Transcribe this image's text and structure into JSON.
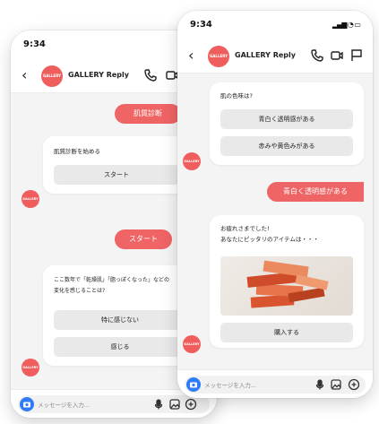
{
  "back_phone": {
    "time": "9:34",
    "brand": "GALLERY Reply",
    "avatar_text": "GALLERY",
    "messages": {
      "user1": "肌質診断",
      "card1_text": "肌質診断を始める",
      "card1_button": "スタート",
      "user2": "スタート",
      "card2_line1": "ここ数年で「乾燥肌」「脂っぽくなった」などの",
      "card2_line2": "変化を感じることは?",
      "card2_opt1": "特に感じない",
      "card2_opt2": "感じる"
    },
    "input_placeholder": "メッセージを入力..."
  },
  "front_phone": {
    "time": "9:34",
    "brand": "GALLERY Reply",
    "avatar_text": "GALLERY",
    "messages": {
      "q_text": "肌の色味は?",
      "q_opt1": "青白く透明感がある",
      "q_opt2": "赤みや黄色みがある",
      "user_answer": "青白く透明感がある",
      "result_line1": "お疲れさまでした!",
      "result_line2": "あなたにピッタリのアイテムは・・・",
      "buy_button": "購入する"
    },
    "input_placeholder": "メッセージを入力..."
  },
  "colors": {
    "accent": "#ef6464",
    "camera": "#2f7cf6"
  }
}
